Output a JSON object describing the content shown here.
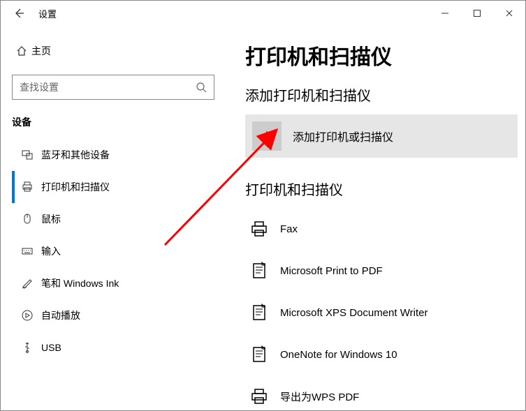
{
  "titlebar": {
    "title": "设置"
  },
  "sidebar": {
    "home": "主页",
    "search_placeholder": "查找设置",
    "section": "设备",
    "items": [
      {
        "label": "蓝牙和其他设备",
        "active": false
      },
      {
        "label": "打印机和扫描仪",
        "active": true
      },
      {
        "label": "鼠标",
        "active": false
      },
      {
        "label": "输入",
        "active": false
      },
      {
        "label": "笔和 Windows Ink",
        "active": false
      },
      {
        "label": "自动播放",
        "active": false
      },
      {
        "label": "USB",
        "active": false
      }
    ]
  },
  "main": {
    "title": "打印机和扫描仪",
    "add_section_title": "添加打印机和扫描仪",
    "add_button_label": "添加打印机或扫描仪",
    "list_section_title": "打印机和扫描仪",
    "printers": [
      {
        "label": "Fax"
      },
      {
        "label": "Microsoft Print to PDF"
      },
      {
        "label": "Microsoft XPS Document Writer"
      },
      {
        "label": "OneNote for Windows 10"
      },
      {
        "label": "导出为WPS PDF"
      }
    ]
  }
}
